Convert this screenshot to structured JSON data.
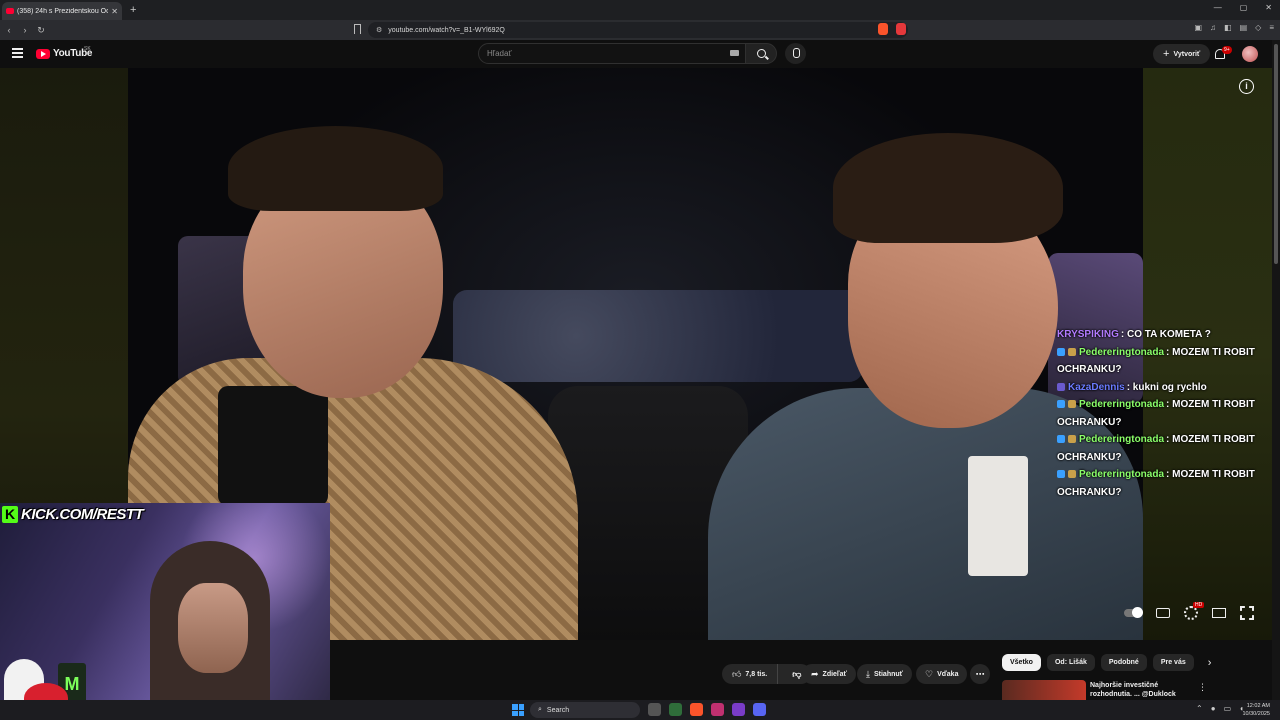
{
  "browser": {
    "tab_title": "(358) 24h s Prezidentskou Ochr...",
    "url": "youtube.com/watch?v=_B1-WYl692Q",
    "new_tab": "+",
    "win_minimize": "—",
    "win_maximize": "▢",
    "win_close": "✕"
  },
  "youtube": {
    "wordmark": "YouTube",
    "country": "SK",
    "search_placeholder": "Hľadať",
    "create_label": "Vytvoriť",
    "notif_count": "9+"
  },
  "overlay": {
    "kick_url": "KICK.COM/RESTT",
    "chat": [
      {
        "user": "KRYSPIKING",
        "text": ": CO TA KOMETA ?",
        "color": "#b27bff",
        "badges": 0
      },
      {
        "user": "Pedereringtonada",
        "text": ": MOZEM TI ROBIT OCHRANKU?",
        "color": "#8bff6a",
        "badges": 2
      },
      {
        "user": "KazaDennis",
        "text": ": kukni og rychlo",
        "color": "#6a7bff",
        "badges": 1
      },
      {
        "user": "Pedereringtonada",
        "text": ": MOZEM TI ROBIT OCHRANKU?",
        "color": "#8bff6a",
        "badges": 2
      },
      {
        "user": "Pedereringtonada",
        "text": ": MOZEM TI ROBIT OCHRANKU?",
        "color": "#8bff6a",
        "badges": 2
      },
      {
        "user": "Pedereringtonada",
        "text": ": MOZEM TI ROBIT OCHRANKU?",
        "color": "#8bff6a",
        "badges": 2
      }
    ]
  },
  "player": {
    "info_symbol": "i",
    "hd_badge": "HD"
  },
  "actions": {
    "like_count": "7,8 tis.",
    "share": "Zdieľať",
    "download": "Stiahnuť",
    "thanks": "Vďaka",
    "more": "⋯"
  },
  "chips": [
    "Všetko",
    "Od: Lišák",
    "Podobné",
    "Pre vás"
  ],
  "recommendation": {
    "title": "Najhoršie investičné rozhodnutia. ... @Duklock",
    "more": "⋮"
  },
  "taskbar": {
    "search_label": "Search",
    "time": "12:02 AM",
    "date": "10/30/2025"
  },
  "colors": {
    "youtube_red": "#ff0033",
    "kick_green": "#53fc18",
    "chat_white": "#ffffff"
  },
  "icons": [
    "menu-icon",
    "search-icon",
    "mic-icon",
    "bell-icon",
    "info-icon",
    "settings-gear-icon",
    "fullscreen-icon",
    "like-icon",
    "dislike-icon",
    "share-icon",
    "download-icon",
    "thanks-icon"
  ]
}
